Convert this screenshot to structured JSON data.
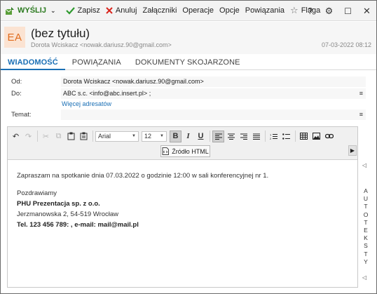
{
  "toolbar": {
    "send": "WYŚLIJ",
    "save": "Zapisz",
    "cancel": "Anuluj",
    "attachments": "Załączniki",
    "operations": "Operacje",
    "options": "Opcje",
    "relations": "Powiązania",
    "flag": "Flaga"
  },
  "header": {
    "avatar_initials": "EA",
    "title": "(bez tytułu)",
    "sender": "Dorota Wciskacz <nowak.dariusz.90@gmail.com>",
    "date": "07-03-2022 08:12"
  },
  "tabs": [
    "WIADOMOŚĆ",
    "POWIĄZANIA",
    "DOKUMENTY SKOJARZONE"
  ],
  "form": {
    "from_label": "Od:",
    "from_value": "Dorota Wciskacz <nowak.dariusz.90@gmail.com>",
    "to_label": "Do:",
    "to_value": "ABC s.c. <info@abc.insert.pl> ;",
    "more_recipients": "Więcej adresatów",
    "subject_label": "Temat:",
    "subject_value": ""
  },
  "editor": {
    "font_family": "Arial",
    "font_size": "12",
    "bold_label": "B",
    "italic_label": "I",
    "underline_label": "U",
    "source_button": "Źródło HTML",
    "body": {
      "line1": "Zapraszam na spotkanie dnia 07.03.2022 o godzinie 12:00 w sali konferencyjnej nr 1.",
      "greeting": "Pozdrawiamy",
      "company": "PHU Prezentacja sp. z o.o.",
      "address": "Jerzmanowska 2, 54-519 Wrocław",
      "contact": "Tel. 123 456 789: , e-mail: mail@mail.pl"
    }
  },
  "side_panel": {
    "label": "AUTOTEKSTY"
  },
  "colors": {
    "accent": "#1a6fb5",
    "send_green": "#2b7a1f",
    "avatar_bg": "#fbe3d2",
    "avatar_fg": "#e06b1c",
    "cancel_red": "#d9241c"
  }
}
